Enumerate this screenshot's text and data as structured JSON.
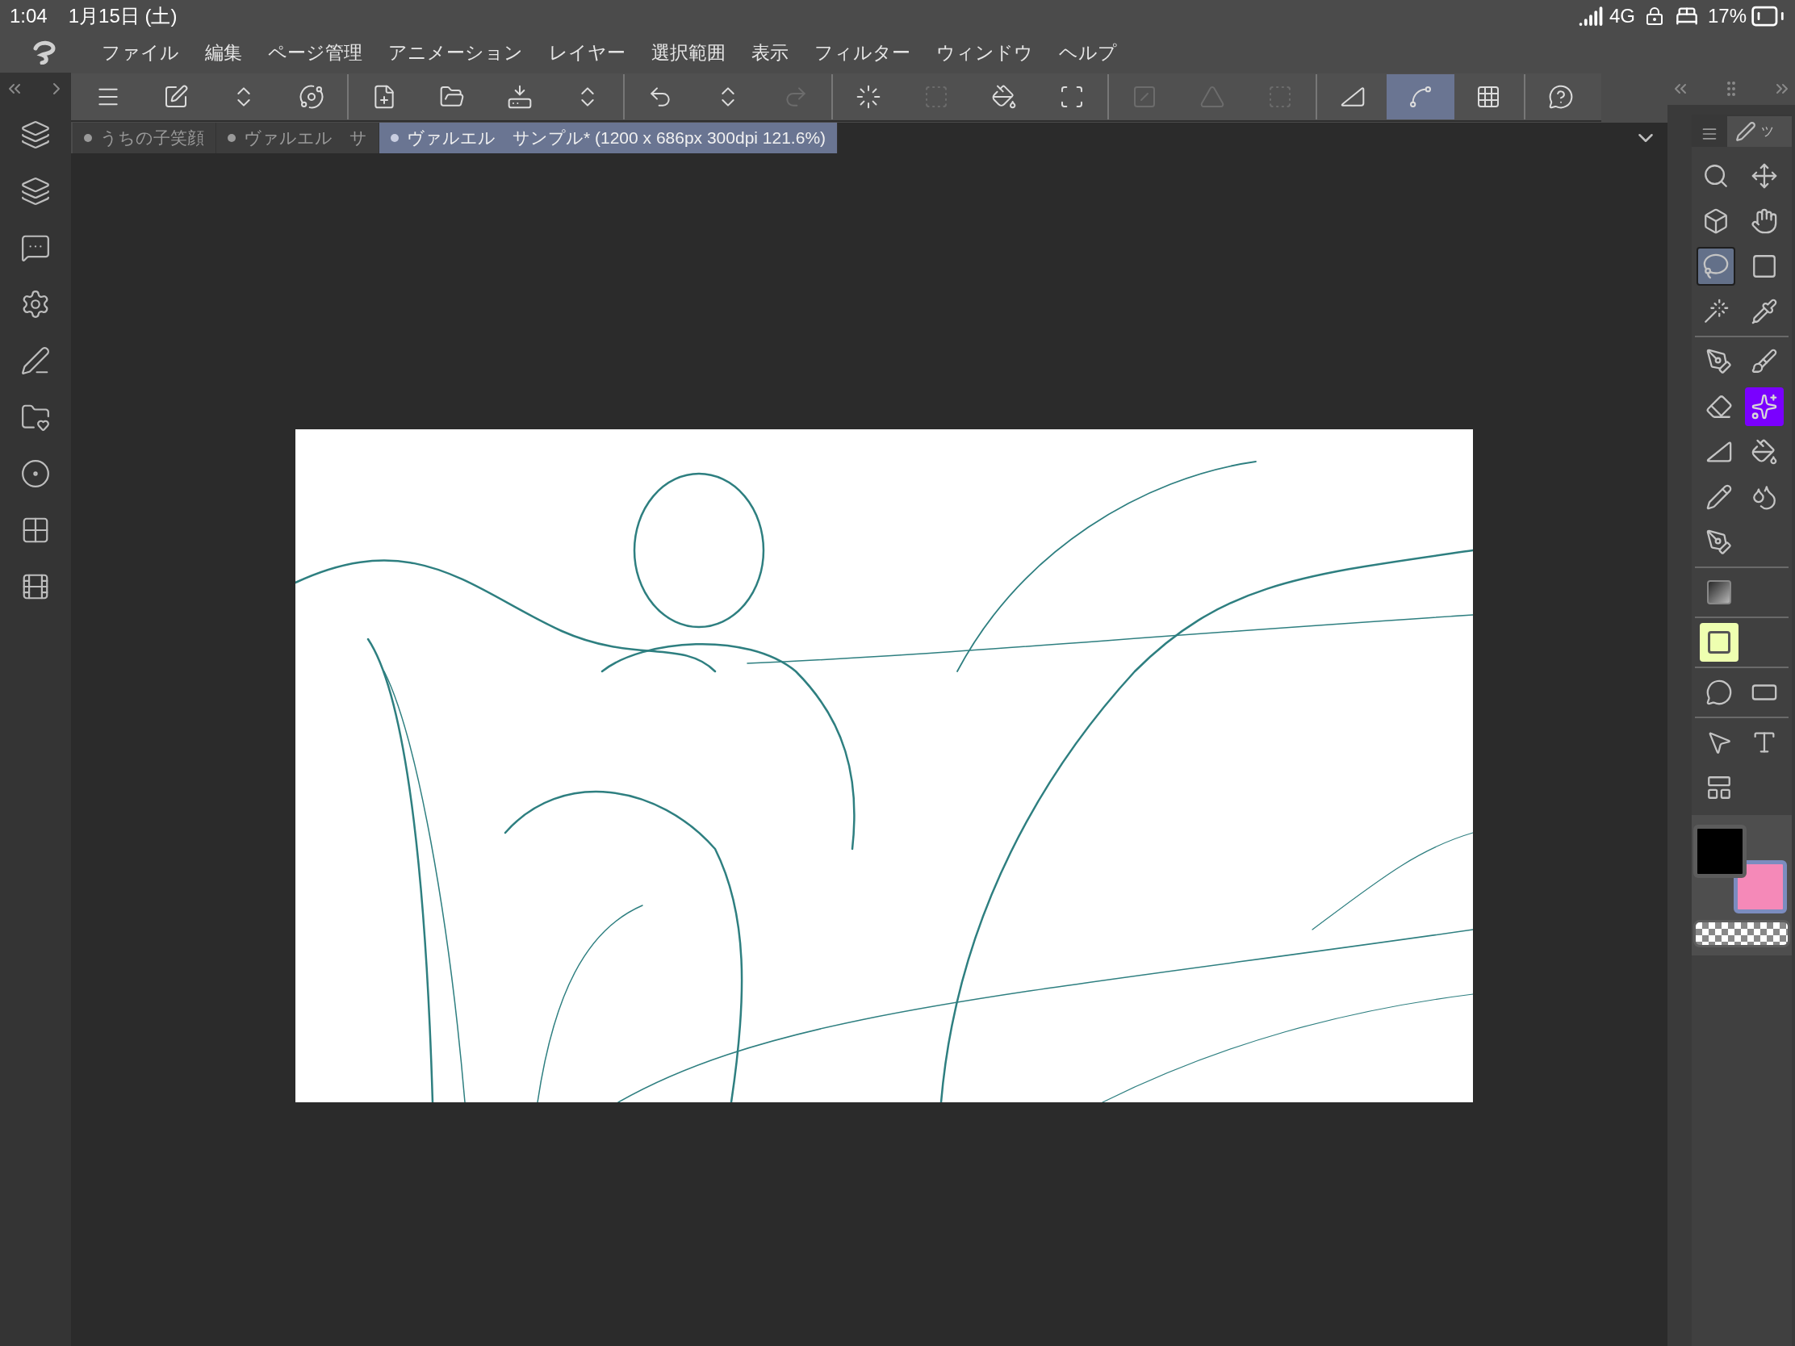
{
  "status_bar": {
    "time": "1:04",
    "date": "1月15日 (土)",
    "network": "4G",
    "battery": "17%"
  },
  "menu": [
    "ファイル",
    "編集",
    "ページ管理",
    "アニメーション",
    "レイヤー",
    "選択範囲",
    "表示",
    "フィルター",
    "ウィンドウ",
    "ヘルプ"
  ],
  "toolbar": [
    [
      {
        "kind": "menu",
        "selected": false,
        "disabled": false
      },
      {
        "kind": "edit",
        "selected": false,
        "disabled": false
      },
      {
        "kind": "updown",
        "selected": false,
        "disabled": false
      },
      {
        "kind": "stamp",
        "selected": false,
        "disabled": false
      }
    ],
    [
      {
        "kind": "new",
        "selected": false,
        "disabled": false
      },
      {
        "kind": "open",
        "selected": false,
        "disabled": false
      },
      {
        "kind": "export",
        "selected": false,
        "disabled": false
      },
      {
        "kind": "updown",
        "selected": false,
        "disabled": false
      }
    ],
    [
      {
        "kind": "undo",
        "selected": false,
        "disabled": false
      },
      {
        "kind": "updown",
        "selected": false,
        "disabled": false
      },
      {
        "kind": "redo",
        "selected": false,
        "disabled": true
      }
    ],
    [
      {
        "kind": "spinner",
        "selected": false,
        "disabled": false
      },
      {
        "kind": "selection",
        "selected": false,
        "disabled": true
      },
      {
        "kind": "fill",
        "selected": false,
        "disabled": false
      },
      {
        "kind": "transform",
        "selected": false,
        "disabled": false
      }
    ],
    [
      {
        "kind": "deselect",
        "selected": false,
        "disabled": true
      },
      {
        "kind": "invert",
        "selected": false,
        "disabled": true
      },
      {
        "kind": "border",
        "selected": false,
        "disabled": true
      }
    ],
    [
      {
        "kind": "ruler",
        "selected": false,
        "disabled": false
      },
      {
        "kind": "curve",
        "selected": true,
        "disabled": false
      },
      {
        "kind": "grid",
        "selected": false,
        "disabled": false
      }
    ],
    [
      {
        "kind": "help",
        "selected": false,
        "disabled": false
      }
    ]
  ],
  "document_tabs": [
    {
      "title": "うちの子笑顔",
      "selected": false
    },
    {
      "title": "ヴァルエル　サ",
      "selected": false
    },
    {
      "title": "ヴァルエル　サンプル* (1200 x 686px 300dpi 121.6%)",
      "selected": true
    }
  ],
  "canvas": {
    "kind": "picture"
  },
  "palette_tab": "ツ",
  "tools": [
    [
      {
        "kind": "zoom",
        "selected": false
      },
      {
        "kind": "move",
        "selected": false
      },
      {
        "kind": "object",
        "selected": false
      },
      {
        "kind": "hand",
        "selected": false
      },
      {
        "kind": "lasso",
        "selected": true
      },
      {
        "kind": "rect",
        "selected": false
      },
      {
        "kind": "wand",
        "selected": false
      },
      {
        "kind": "eyedropper",
        "selected": false
      }
    ],
    [
      {
        "kind": "pen",
        "selected": false
      },
      {
        "kind": "brush",
        "selected": false
      },
      {
        "kind": "eraser",
        "selected": false
      },
      {
        "kind": "sparkle",
        "selected": false
      },
      {
        "kind": "ruler",
        "selected": false
      },
      {
        "kind": "fill",
        "selected": false
      },
      {
        "kind": "pencil",
        "selected": false
      },
      {
        "kind": "blend",
        "selected": false
      },
      {
        "kind": "pen",
        "selected": false
      }
    ],
    [
      {
        "kind": "gradient",
        "selected": false
      }
    ],
    [
      {
        "kind": "frame",
        "selected": false
      }
    ],
    [
      {
        "kind": "balloon",
        "selected": false
      },
      {
        "kind": "line",
        "selected": false
      }
    ],
    [
      {
        "kind": "operation",
        "selected": false
      },
      {
        "kind": "text",
        "selected": false
      },
      {
        "kind": "layout",
        "selected": false
      }
    ]
  ],
  "colors": [
    {
      "color": "#000000",
      "selected": false
    },
    {
      "color": "#f589b8",
      "selected": true
    }
  ]
}
